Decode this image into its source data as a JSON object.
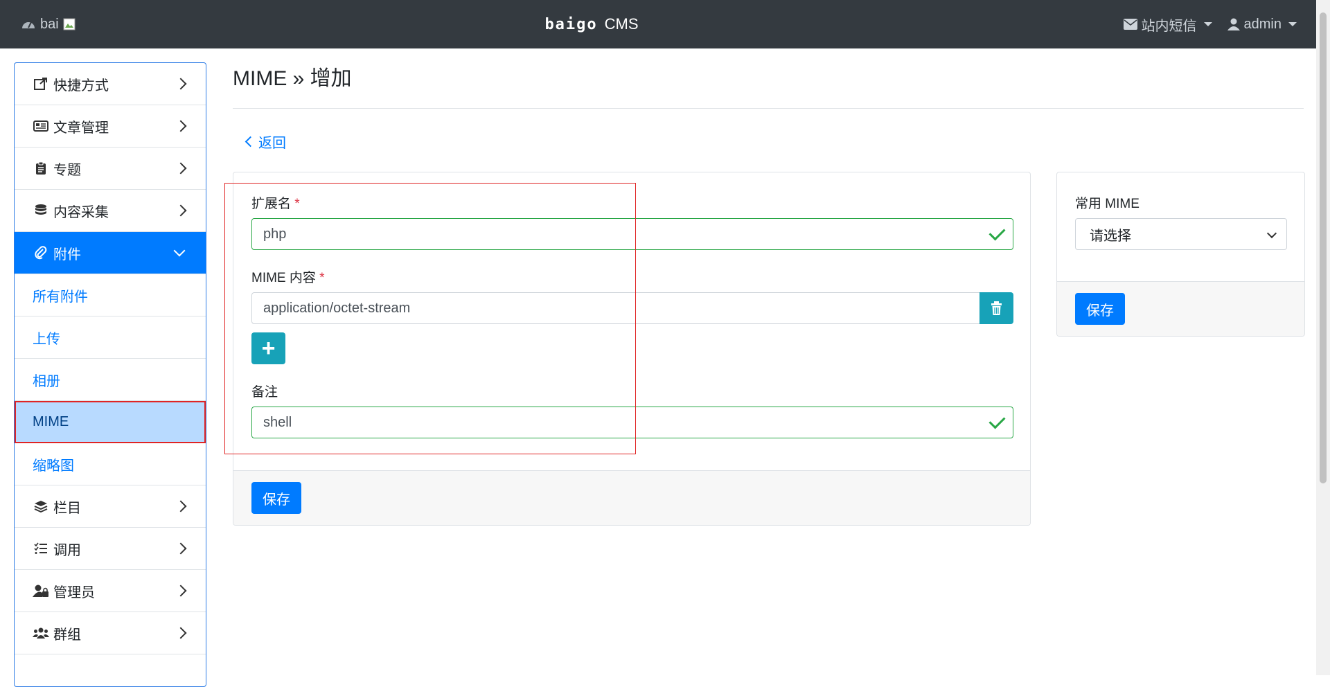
{
  "navbar": {
    "logo_text": "bai",
    "brand": "baigo",
    "brand_suffix": "CMS",
    "messages": "站内短信",
    "user": "admin"
  },
  "sidebar": {
    "items": [
      {
        "label": "快捷方式",
        "icon": "external-link-icon"
      },
      {
        "label": "文章管理",
        "icon": "newspaper-icon"
      },
      {
        "label": "专题",
        "icon": "clipboard-icon"
      },
      {
        "label": "内容采集",
        "icon": "database-icon"
      },
      {
        "label": "附件",
        "icon": "paperclip-icon"
      },
      {
        "label": "所有附件"
      },
      {
        "label": "上传"
      },
      {
        "label": "相册"
      },
      {
        "label": "MIME"
      },
      {
        "label": "缩略图"
      },
      {
        "label": "栏目",
        "icon": "layers-icon"
      },
      {
        "label": "调用",
        "icon": "tasks-icon"
      },
      {
        "label": "管理员",
        "icon": "user-lock-icon"
      },
      {
        "label": "群组",
        "icon": "users-icon"
      }
    ]
  },
  "page": {
    "title": "MIME » 增加",
    "back": "返回"
  },
  "form": {
    "ext_label": "扩展名",
    "ext_value": "php",
    "mime_label": "MIME 内容",
    "mime_value": "application/octet-stream",
    "note_label": "备注",
    "note_value": "shell",
    "required_mark": "*",
    "plus": "+",
    "save": "保存"
  },
  "side_card": {
    "label": "常用 MIME",
    "select_value": "请选择",
    "save": "保存"
  }
}
